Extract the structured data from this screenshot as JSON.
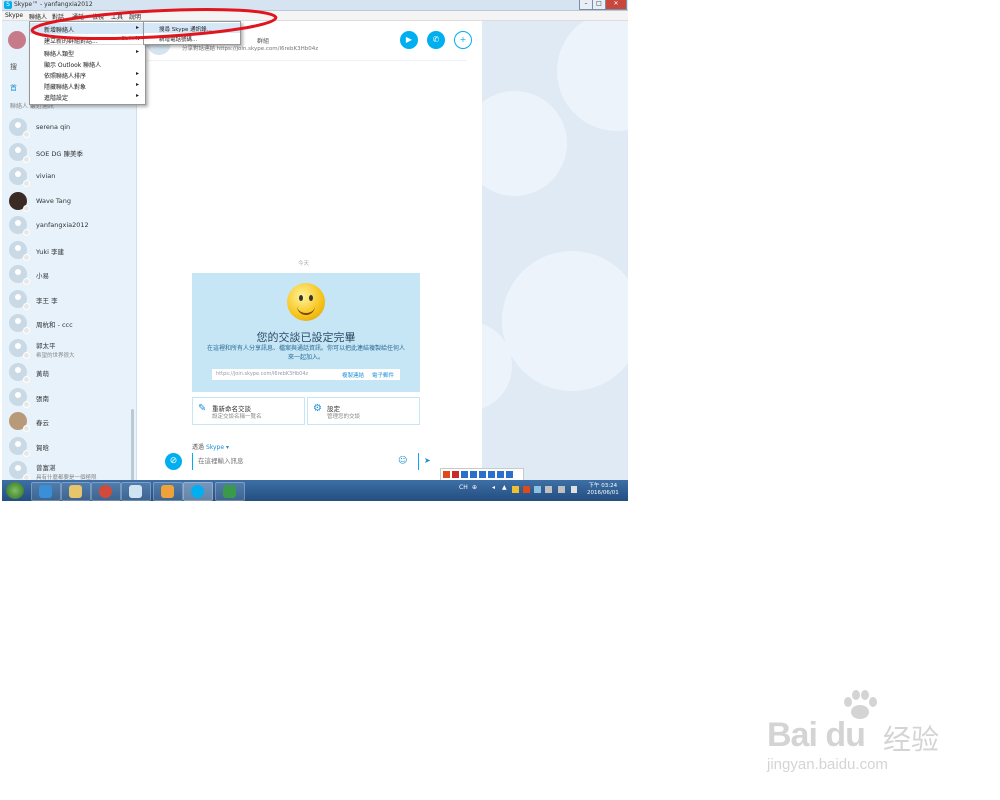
{
  "window": {
    "title": "Skype™ - yanfangxia2012",
    "minimize_glyph": "–",
    "maximize_glyph": "□",
    "close_glyph": "✕",
    "icon": "S"
  },
  "menubar": [
    "Skype",
    "聯絡人",
    "對話",
    "通話",
    "檢視",
    "工具",
    "說明"
  ],
  "contacts_menu": {
    "items": [
      {
        "label": "新增聯絡人",
        "key": "",
        "arrow": "▸"
      },
      {
        "label": "建立新的群組對話...",
        "key": "Ctrl+N",
        "arrow": ""
      },
      {
        "label": "聯絡人類型",
        "key": "",
        "arrow": "▸"
      },
      {
        "label": "顯示 Outlook 聯絡人",
        "key": "",
        "arrow": ""
      },
      {
        "label": "依照聯絡人排序",
        "key": "",
        "arrow": "▸"
      },
      {
        "label": "隱藏聯絡人對象",
        "key": "",
        "arrow": "▸"
      },
      {
        "label": "進階設定",
        "key": "",
        "arrow": "▸"
      }
    ],
    "submenu": [
      "搜尋 Skype 通訊錄...",
      "新增電話號碼..."
    ]
  },
  "sidebar": {
    "search_label": "搜",
    "home_label": "首",
    "tabs_label": "聯絡人  最近通訊",
    "contacts": [
      {
        "name": "serena qin",
        "sub": "",
        "avatar": "default"
      },
      {
        "name": "SOE DG 陳美季",
        "sub": "",
        "avatar": "default"
      },
      {
        "name": "vivian",
        "sub": "",
        "avatar": "default"
      },
      {
        "name": "Wave Tang",
        "sub": "",
        "avatar": "photo"
      },
      {
        "name": "yanfangxia2012",
        "sub": "",
        "avatar": "default"
      },
      {
        "name": "Yuki 李建",
        "sub": "",
        "avatar": "default"
      },
      {
        "name": "小易",
        "sub": "",
        "avatar": "default"
      },
      {
        "name": "李王 李",
        "sub": "",
        "avatar": "default"
      },
      {
        "name": "周杭和 - ccc",
        "sub": "",
        "avatar": "default"
      },
      {
        "name": "郭太平",
        "sub": "希望的世界很大",
        "avatar": "default"
      },
      {
        "name": "黃萌",
        "sub": "",
        "avatar": "default"
      },
      {
        "name": "張南",
        "sub": "",
        "avatar": "default"
      },
      {
        "name": "春云",
        "sub": "",
        "avatar": "photo2"
      },
      {
        "name": "賀晗",
        "sub": "",
        "avatar": "default"
      },
      {
        "name": "曾富湛",
        "sub": "具有什麼都要是一個極限",
        "avatar": "default"
      }
    ]
  },
  "conversation": {
    "header_title": "群組",
    "header_link": "分享對話連結 https://join.skype.com/l6rebK3Hb04z",
    "today_label": "今天",
    "card": {
      "title": "您的交談已設定完畢",
      "description": "在這裡和所有人分享訊息、檔案與通話資訊。你可以把此連結複製給任何人來一起加入。",
      "link_url": "https://join.skype.com/l6rebK3Hb04z",
      "copy_label": "複製連結",
      "email_label": "電子郵件"
    },
    "actions": [
      {
        "icon": "✎",
        "title": "重新命名交談",
        "subtitle": "設定交談名稱一覽名"
      },
      {
        "icon": "⚙",
        "title": "設定",
        "subtitle": "管理您的交談"
      }
    ],
    "send_via_prefix": "透過",
    "send_via_service": "Skype ▾",
    "input_placeholder": "在這裡輸入訊息",
    "attach_icon": "⊘",
    "emoji_icon": "☺",
    "send_icon": "➤"
  },
  "header_buttons": [
    "▶",
    "✆",
    "+"
  ],
  "taskbar": {
    "tray_labels": [
      "CH",
      "⊕",
      "◂",
      "▲"
    ],
    "clock_time": "下午 03:24",
    "clock_date": "2016/06/01"
  },
  "watermark": {
    "logo": "Bai du",
    "brand": "经验",
    "url": "jingyan.baidu.com"
  },
  "colors": {
    "skype_blue": "#00aff0",
    "sidebar": "#e7f2fb",
    "card": "#c6e6f6",
    "annotation": "#e0151d"
  }
}
